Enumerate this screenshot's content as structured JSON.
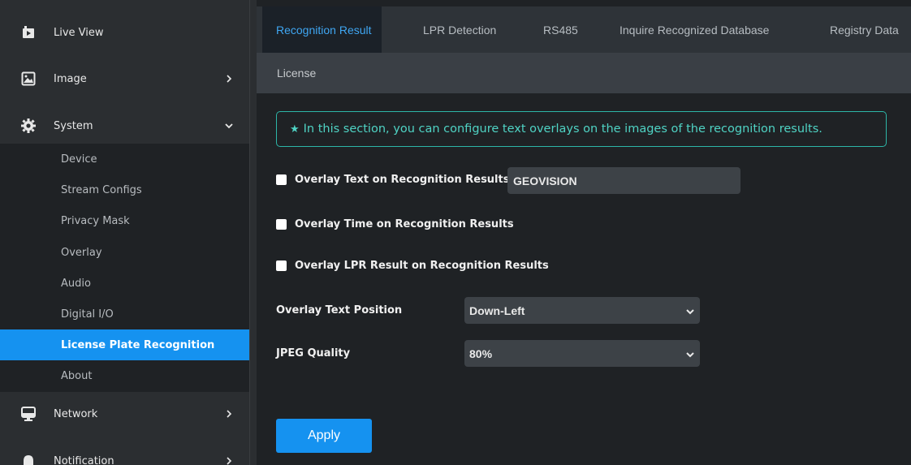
{
  "sidebar": {
    "live_view": "Live View",
    "image": "Image",
    "system": "System",
    "system_items": [
      "Device",
      "Stream Configs",
      "Privacy Mask",
      "Overlay",
      "Audio",
      "Digital I/O",
      "License Plate Recognition",
      "About"
    ],
    "active_item": "License Plate Recognition",
    "network": "Network",
    "notification": "Notification",
    "icons": {
      "live_view": "video-camera-icon",
      "image": "image-icon",
      "system": "gear-icon",
      "network": "monitor-icon",
      "notification": "bell-icon"
    }
  },
  "tabs": [
    "Recognition Result",
    "LPR Detection",
    "RS485",
    "Inquire Recognized Database",
    "Registry Data"
  ],
  "active_tab": "Recognition Result",
  "subtab": "License",
  "notice": {
    "star": "★",
    "text": "In this section, you can configure text overlays on the images of the recognition results."
  },
  "options": {
    "overlay_text_label": "Overlay Text on Recognition Results",
    "overlay_text_value": "GEOVISION",
    "overlay_time_label": "Overlay Time on Recognition Results",
    "overlay_lpr_label": "Overlay LPR Result on Recognition Results"
  },
  "position": {
    "label": "Overlay Text Position",
    "value": "Down-Left"
  },
  "quality": {
    "label": "JPEG Quality",
    "value": "80%"
  },
  "apply_label": "Apply",
  "colors": {
    "accent": "#1592f0",
    "notice_teal": "#2db6a8",
    "active_tab_text": "#3fa6f2",
    "sidebar_bg": "#2b2e31"
  }
}
